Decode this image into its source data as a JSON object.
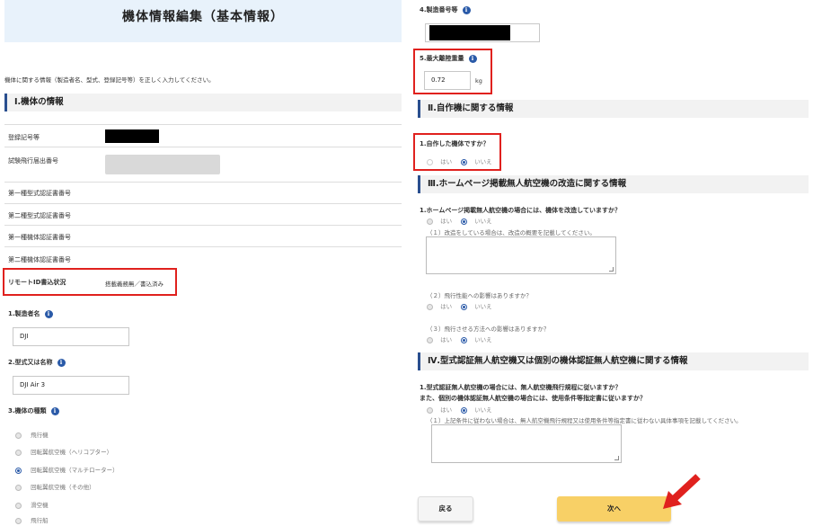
{
  "header": {
    "title": "機体情報編集（基本情報）"
  },
  "intro": "機体に関する情報（製造者名、型式、登録記号等）を正しく入力してください。",
  "section1": {
    "title": "Ⅰ.機体の情報",
    "rows": [
      {
        "label": "登録記号等",
        "value": ""
      },
      {
        "label": "試験飛行届出番号",
        "value": ""
      },
      {
        "label": "第一種型式認証書番号",
        "value": ""
      },
      {
        "label": "第二種型式認証書番号",
        "value": ""
      },
      {
        "label": "第一種機体認証書番号",
        "value": ""
      },
      {
        "label": "第二種機体認証書番号",
        "value": ""
      },
      {
        "label": "リモートID書込状況",
        "value": "搭載義務無／書込済み"
      }
    ]
  },
  "fields": {
    "manufacturer": {
      "label": "1.製造者名",
      "value": "DJI"
    },
    "model": {
      "label": "2.型式又は名称",
      "value": "DJI Air 3"
    },
    "type": {
      "label": "3.機体の種類",
      "options": [
        "飛行機",
        "回転翼航空機（ヘリコプター）",
        "回転翼航空機（マルチローター）",
        "回転翼航空機（その他）",
        "滑空機",
        "飛行船"
      ],
      "selected": "回転翼航空機（マルチローター）"
    },
    "serial": {
      "label": "4.製造番号等",
      "value": ""
    },
    "max_weight": {
      "label": "5.最大離陸重量",
      "value": "0.72",
      "unit": "kg"
    }
  },
  "section2": {
    "title": "Ⅱ.自作機に関する情報",
    "question": "1.自作した機体ですか？",
    "options": [
      "はい",
      "いいえ"
    ],
    "selected": "いいえ"
  },
  "section3": {
    "title": "Ⅲ.ホームページ掲載無人航空機の改造に関する情報",
    "q1": "1.ホームページ掲載無人航空機の場合には、機体を改造していますか？",
    "options": [
      "はい",
      "いいえ"
    ],
    "note1": "（１）改造をしている場合は、改造の概要を記載してください。",
    "note2": "（２）飛行性能への影響はありますか？",
    "note3": "（３）飛行させる方法への影響はありますか？"
  },
  "section4": {
    "title": "Ⅳ.型式認証無人航空機又は個別の機体認証無人航空機に関する情報",
    "q1": "1.型式認証無人航空機の場合には、無人航空機飛行規程に従いますか？",
    "q2": "また、個別の機体認証無人航空機の場合には、使用条件等指定書に従いますか？",
    "options": [
      "はい",
      "いいえ"
    ],
    "note1": "（１）上記条件に従わない場合は、無人航空機飛行規程又は使用条件等指定書に従わない具体事項を記載してください。"
  },
  "buttons": {
    "back": "戻る",
    "next": "次へ"
  },
  "colors": {
    "accent": "#2a5aa8",
    "highlight": "#e0211e",
    "next_button": "#f8d066"
  }
}
